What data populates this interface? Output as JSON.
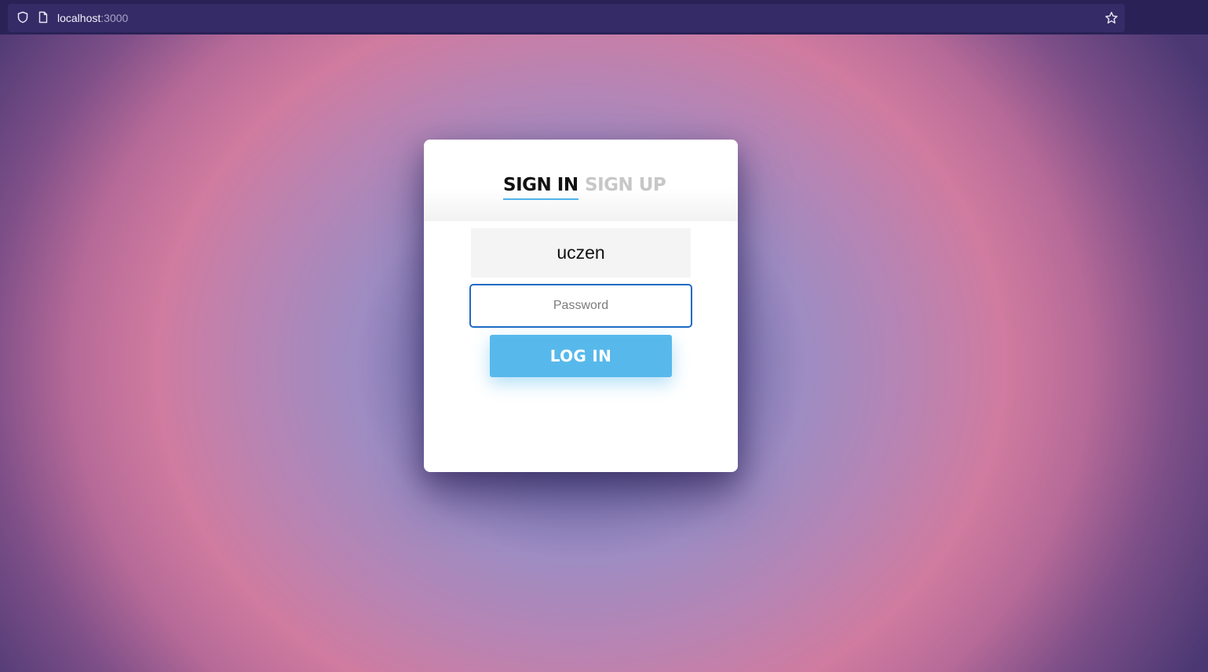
{
  "browser": {
    "url_host": "localhost",
    "url_port": ":3000",
    "icons": {
      "shield": "shield-icon",
      "page": "page-icon",
      "star": "star-icon"
    }
  },
  "auth": {
    "tabs": [
      {
        "label": "SIGN IN",
        "active": true
      },
      {
        "label": "SIGN UP",
        "active": false
      }
    ],
    "username_value": "uczen",
    "password_placeholder": "Password",
    "login_label": "LOG IN"
  },
  "colors": {
    "accent": "#57b9eb",
    "focus_border": "#1d6bc5",
    "active_tab_text": "#111111",
    "inactive_tab_text": "#c7c7c7",
    "browser_bar": "#2a2257"
  }
}
